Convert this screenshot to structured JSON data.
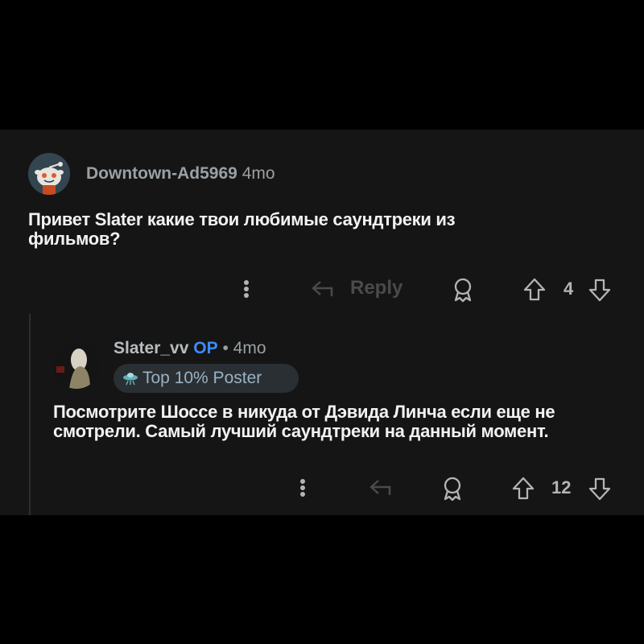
{
  "comments": [
    {
      "username": "Downtown-Ad5969",
      "time": "4mo",
      "text": "Привет Slater какие твои любимые саундтреки из фильмов?",
      "reply_label": "Reply",
      "vote_count": "4",
      "icons": [
        "more-vertical-icon",
        "reply-icon",
        "award-icon",
        "upvote-icon",
        "downvote-icon"
      ]
    },
    {
      "username": "Slater_vv",
      "op_label": "OP",
      "separator": "•",
      "time": "4mo",
      "badge": "Top 10% Poster",
      "text": "Посмотрите Шоссе в никуда от Дэвида Линча если еще не смотрели. Самый лучший саундтреки на данный момент.",
      "vote_count": "12",
      "icons": [
        "more-vertical-icon",
        "reply-icon",
        "award-icon",
        "upvote-icon",
        "downvote-icon"
      ]
    }
  ],
  "colors": {
    "background": "#000000",
    "panel": "#151515",
    "op": "#3b8cff",
    "badge_bg": "#2a2f33",
    "text": "#f2f2f2",
    "meta": "#9aa0a4"
  }
}
